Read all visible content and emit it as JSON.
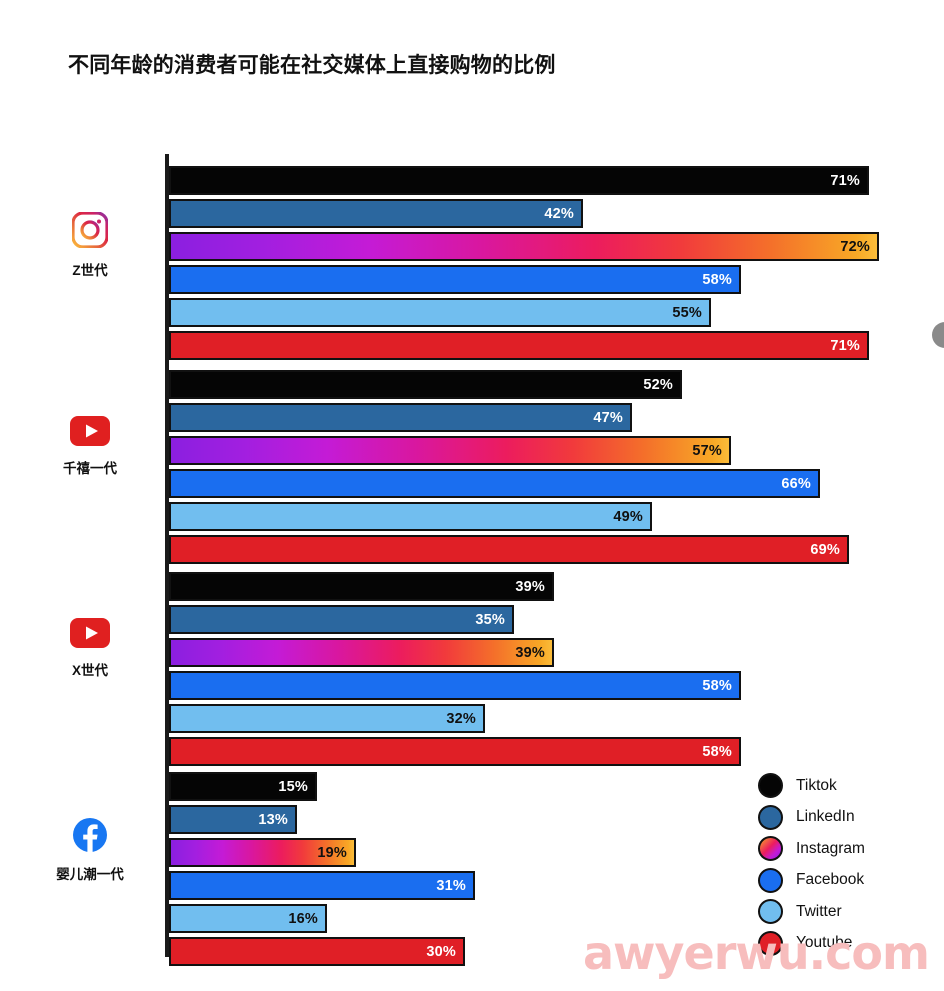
{
  "title": "不同年龄的消费者可能在社交媒体上直接购物的比例",
  "watermark": "awyerwu.com",
  "legend": {
    "items": [
      {
        "label": "Tiktok",
        "color": "#050505",
        "icon": "circle-swatch-icon"
      },
      {
        "label": "LinkedIn",
        "color": "#2B679F",
        "icon": "circle-swatch-icon"
      },
      {
        "label": "Instagram",
        "color": "#C41BD6",
        "icon": "circle-swatch-icon"
      },
      {
        "label": "Facebook",
        "color": "#1A6EF0",
        "icon": "circle-swatch-icon"
      },
      {
        "label": "Twitter",
        "color": "#71BEEF",
        "icon": "circle-swatch-icon"
      },
      {
        "label": "Youtube",
        "color": "#E01F26",
        "icon": "circle-swatch-icon"
      }
    ]
  },
  "categories_meta": [
    {
      "name": "Z世代",
      "icon": "instagram-icon"
    },
    {
      "name": "千禧一代",
      "icon": "youtube-icon"
    },
    {
      "name": "X世代",
      "icon": "youtube-icon"
    },
    {
      "name": "婴儿潮一代",
      "icon": "facebook-icon"
    }
  ],
  "bar_labels": {
    "g0": [
      "71%",
      "42%",
      "72%",
      "58%",
      "55%",
      "71%"
    ],
    "g1": [
      "52%",
      "47%",
      "57%",
      "66%",
      "49%",
      "69%"
    ],
    "g2": [
      "39%",
      "35%",
      "39%",
      "58%",
      "32%",
      "58%"
    ],
    "g3": [
      "15%",
      "13%",
      "19%",
      "31%",
      "16%",
      "30%"
    ]
  },
  "chart_data": {
    "type": "bar",
    "orientation": "horizontal",
    "title": "不同年龄的消费者可能在社交媒体上直接购物的比例",
    "xlabel": "",
    "ylabel": "",
    "xlim": [
      0,
      100
    ],
    "unit": "%",
    "grid": false,
    "legend_position": "bottom-right",
    "categories": [
      "Z世代",
      "千禧一代",
      "X世代",
      "婴儿潮一代"
    ],
    "series": [
      {
        "name": "Tiktok",
        "color": "#050505",
        "values": [
          71,
          52,
          39,
          15
        ]
      },
      {
        "name": "LinkedIn",
        "color": "#2B679F",
        "values": [
          42,
          47,
          35,
          13
        ]
      },
      {
        "name": "Instagram",
        "color": "#C41BD6",
        "values": [
          72,
          57,
          39,
          19
        ]
      },
      {
        "name": "Facebook",
        "color": "#1A6EF0",
        "values": [
          58,
          66,
          58,
          31
        ]
      },
      {
        "name": "Twitter",
        "color": "#71BEEF",
        "values": [
          55,
          49,
          32,
          16
        ]
      },
      {
        "name": "Youtube",
        "color": "#E01F26",
        "values": [
          71,
          69,
          58,
          30
        ]
      }
    ]
  }
}
